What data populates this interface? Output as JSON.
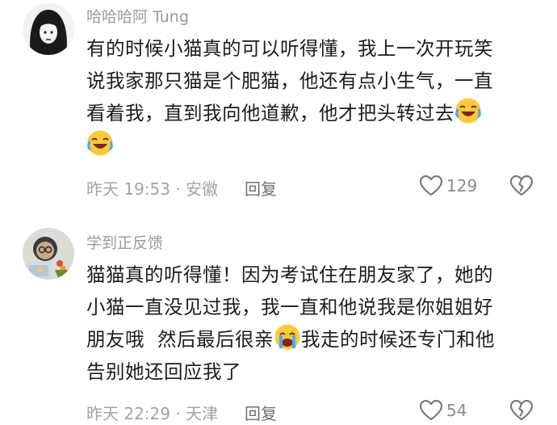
{
  "comments": [
    {
      "username": "哈哈哈阿 Tung",
      "lines": [
        "有的时候小猫真的可以听得懂，我上一次开玩笑",
        "说我家那只猫是个肥猫，他还有点小生气，一直",
        "看着我，直到我向他道歉，他才把头转过去"
      ],
      "emoji": "laughing-crying-emoji",
      "time": "昨天 19:53 · 安徽",
      "reply_label": "回复",
      "like_count": "129"
    },
    {
      "username": "学到正反馈",
      "line1": "猫猫真的听得懂！因为考试住在朋友家了，她的",
      "line2": "小猫一直没见过我，我一直和他说我是你姐姐好",
      "line3_a": "朋友哦  然后最后很亲",
      "emoji": "crying-emoji",
      "line3_b": "我走的时候还专门和他",
      "line4": "告别她还回应我了",
      "time": "昨天 22:29 · 天津",
      "reply_label": "回复",
      "like_count": "54"
    }
  ],
  "colors": {
    "username": "#9a9a9a",
    "body": "#1c1c1c",
    "meta": "#a3a3a3",
    "emoji": "#ffc83d"
  }
}
